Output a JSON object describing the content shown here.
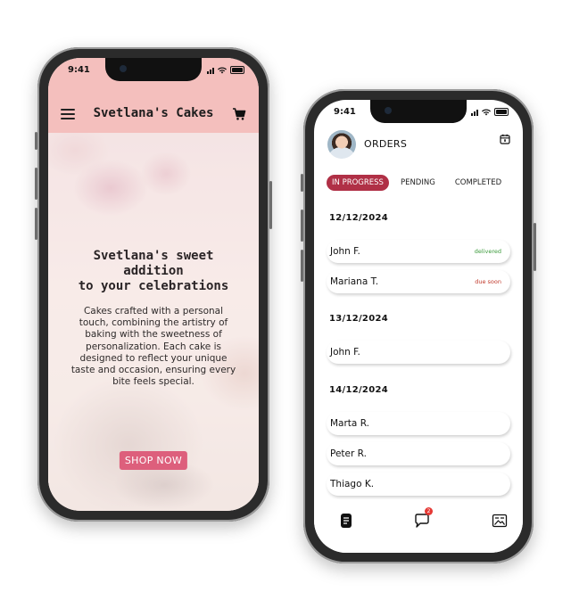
{
  "left_phone": {
    "status_time": "9:41",
    "app_title": "Svetlana's Cakes",
    "hero_heading_lines": [
      "Svetlana's sweet",
      "addition",
      "to your celebrations"
    ],
    "hero_text_lines": [
      "Cakes crafted with a personal",
      "touch, combining the artistry of",
      "baking with the sweetness of",
      "personalization. Each cake is",
      "designed to reflect your unique",
      "taste and occasion, ensuring every",
      "bite feels special."
    ],
    "cta_label": "SHOP NOW",
    "icons": {
      "menu": "hamburger-menu-icon",
      "cart": "shopping-cart-icon"
    },
    "colors": {
      "header": "#f4bfbd",
      "cta": "#dd5f7c"
    }
  },
  "right_phone": {
    "status_time": "9:41",
    "page_title": "ORDERS",
    "tabs": [
      {
        "label": "IN PROGRESS",
        "active": true
      },
      {
        "label": "PENDING",
        "active": false
      },
      {
        "label": "COMPLETED",
        "active": false
      }
    ],
    "groups": [
      {
        "date": "12/12/2024",
        "orders": [
          {
            "name": "John F.",
            "status": "delivered",
            "status_color": "#3a9a3a"
          },
          {
            "name": "Mariana T.",
            "status": "due soon",
            "status_color": "#c0392b"
          }
        ]
      },
      {
        "date": "13/12/2024",
        "orders": [
          {
            "name": "John F.",
            "status": "",
            "status_color": ""
          }
        ]
      },
      {
        "date": "14/12/2024",
        "orders": [
          {
            "name": "Marta R.",
            "status": "",
            "status_color": ""
          },
          {
            "name": "Peter R.",
            "status": "",
            "status_color": ""
          },
          {
            "name": "Thiago K.",
            "status": "",
            "status_color": ""
          }
        ]
      }
    ],
    "nav": {
      "orders_icon": "document-list-icon",
      "chat_icon": "chat-bubble-icon",
      "chat_badge": "2",
      "gallery_icon": "image-gallery-icon"
    },
    "colors": {
      "accent": "#b03046",
      "badge": "#e53935"
    }
  }
}
